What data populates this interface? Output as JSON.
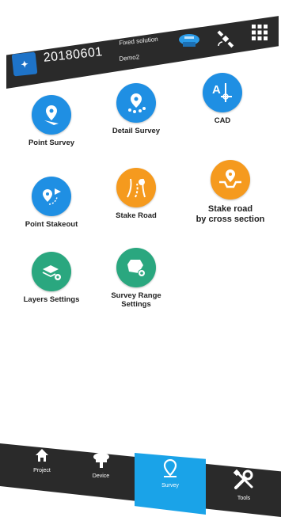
{
  "header": {
    "project_name": "20180601",
    "fix_status": "Fixed solution",
    "device_name": "Demo2",
    "icons": [
      "project-badge-icon",
      "receiver-icon",
      "satellite-icon",
      "grid-menu-icon"
    ]
  },
  "survey_menu": {
    "items": [
      {
        "label": "Point Survey",
        "icon": "point-survey-icon",
        "color": "#1f8fe3"
      },
      {
        "label": "Detail Survey",
        "icon": "detail-survey-icon",
        "color": "#1f8fe3"
      },
      {
        "label": "CAD",
        "icon": "cad-icon",
        "color": "#1f8fe3"
      },
      {
        "label": "Point Stakeout",
        "icon": "point-stakeout-icon",
        "color": "#1f8fe3"
      },
      {
        "label": "Stake Road",
        "icon": "stake-road-icon",
        "color": "#f59a1e"
      },
      {
        "label": "Stake road\nby cross section",
        "icon": "cross-section-icon",
        "color": "#f59a1e"
      },
      {
        "label": "Layers Settings",
        "icon": "layers-settings-icon",
        "color": "#2aa77f"
      },
      {
        "label": "Survey Range\nSettings",
        "icon": "survey-range-icon",
        "color": "#2aa77f"
      }
    ]
  },
  "bottom_nav": {
    "tabs": [
      {
        "label": "Project",
        "icon": "home-icon"
      },
      {
        "label": "Device",
        "icon": "device-icon"
      },
      {
        "label": "Survey",
        "icon": "survey-pin-icon",
        "active": true
      },
      {
        "label": "Tools",
        "icon": "tools-icon"
      }
    ],
    "active_color": "#1aa3e8"
  }
}
